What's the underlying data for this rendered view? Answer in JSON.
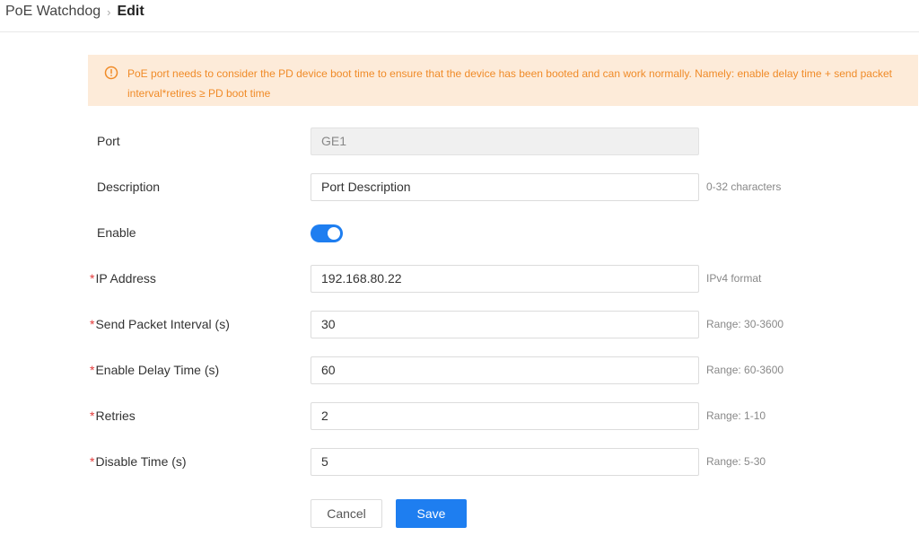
{
  "breadcrumb": {
    "parent": "PoE Watchdog",
    "separator": "›",
    "current": "Edit"
  },
  "alert": {
    "icon": "warning-circle-icon",
    "color": "#f08b28",
    "background": "#fdebd9",
    "text": "PoE port needs to consider the PD device boot time to ensure that the device has been booted and can work normally. Namely: enable delay time + send packet interval*retires ≥ PD boot time"
  },
  "form": {
    "required_mark": "*",
    "port": {
      "label": "Port",
      "value": "GE1"
    },
    "description": {
      "label": "Description",
      "value": "Port Description",
      "hint": "0-32 characters"
    },
    "enable": {
      "label": "Enable",
      "on": true
    },
    "ip_address": {
      "label": "IP Address",
      "value": "192.168.80.22",
      "hint": "IPv4 format"
    },
    "send_packet_interval": {
      "label": "Send Packet Interval (s)",
      "value": "30",
      "hint": "Range: 30-3600"
    },
    "enable_delay_time": {
      "label": "Enable Delay Time (s)",
      "value": "60",
      "hint": "Range: 60-3600"
    },
    "retries": {
      "label": "Retries",
      "value": "2",
      "hint": "Range: 1-10"
    },
    "disable_time": {
      "label": "Disable Time (s)",
      "value": "5",
      "hint": "Range: 5-30"
    }
  },
  "buttons": {
    "cancel": "Cancel",
    "save": "Save"
  },
  "colors": {
    "accent": "#1e7ef0",
    "required": "#e23a3a"
  }
}
